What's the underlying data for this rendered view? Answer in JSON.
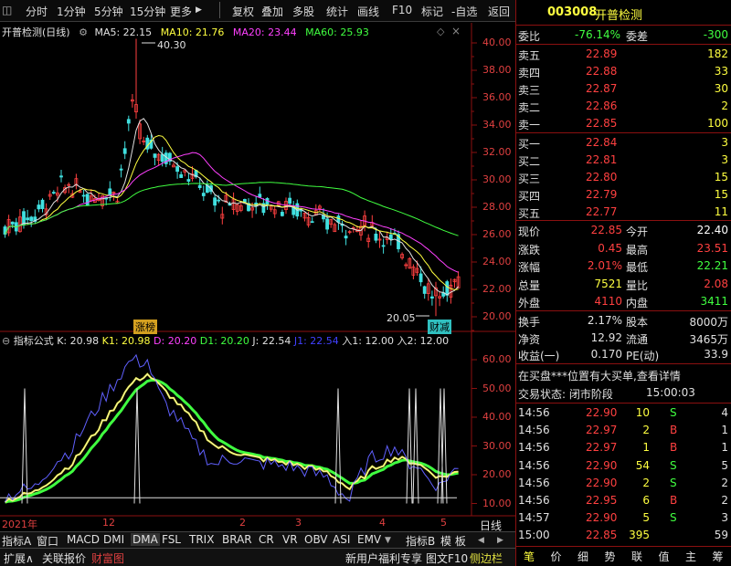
{
  "toolbar": {
    "items": [
      "分时",
      "1分钟",
      "5分钟",
      "15分钟",
      "更多",
      "复权",
      "叠加",
      "多股",
      "统计",
      "画线",
      "F10",
      "标记",
      "-自选",
      "返回"
    ]
  },
  "stock": {
    "code": "003008",
    "name": "开普检测",
    "period": "开普检测(日线)"
  },
  "ma": {
    "ma5": "MA5: 22.15",
    "ma10": "MA10: 21.76",
    "ma20": "MA20: 23.44",
    "ma60": "MA60: 25.93"
  },
  "price_axis": [
    "40.00",
    "38.00",
    "36.00",
    "34.00",
    "32.00",
    "30.00",
    "28.00",
    "26.00",
    "24.00",
    "22.00",
    "20.00"
  ],
  "annotations": {
    "high": "40.30",
    "low": "20.05",
    "tag1": "涨榜",
    "tag2": "财减"
  },
  "indicator": {
    "name": "指标公式",
    "k": "K: 20.98",
    "k1": "K1: 20.98",
    "d": "D: 20.20",
    "d1": "D1: 20.20",
    "j": "J: 22.54",
    "j1": "J1: 22.54",
    "in1": "入1: 12.00",
    "in2": "入2: 12.00"
  },
  "indicator_axis": [
    "60.00",
    "50.00",
    "40.00",
    "30.00",
    "20.00",
    "10.00"
  ],
  "time_axis": {
    "year": "2021年",
    "months": [
      "12",
      "2",
      "3",
      "4",
      "5"
    ],
    "period_btn": "日线"
  },
  "indicator_tabs": [
    "指标A",
    "窗口",
    "MACD",
    "DMI",
    "DMA",
    "FSL",
    "TRIX",
    "BRAR",
    "CR",
    "VR",
    "OBV",
    "ASI",
    "EMV"
  ],
  "indicator_tabs_right": [
    "指标B",
    "模 板"
  ],
  "bottom": {
    "left": [
      "扩展∧",
      "关联报价",
      "财富图"
    ],
    "right": [
      "新用户福利专享",
      "图文F10",
      "侧边栏"
    ]
  },
  "quote": {
    "weibi_label": "委比",
    "weibi": "-76.14%",
    "weicha_label": "委差",
    "weicha": "-300",
    "asks": [
      {
        "label": "卖五",
        "price": "22.89",
        "vol": "182"
      },
      {
        "label": "卖四",
        "price": "22.88",
        "vol": "33"
      },
      {
        "label": "卖三",
        "price": "22.87",
        "vol": "30"
      },
      {
        "label": "卖二",
        "price": "22.86",
        "vol": "2"
      },
      {
        "label": "卖一",
        "price": "22.85",
        "vol": "100"
      }
    ],
    "bids": [
      {
        "label": "买一",
        "price": "22.84",
        "vol": "3"
      },
      {
        "label": "买二",
        "price": "22.81",
        "vol": "3"
      },
      {
        "label": "买三",
        "price": "22.80",
        "vol": "15"
      },
      {
        "label": "买四",
        "price": "22.79",
        "vol": "15"
      },
      {
        "label": "买五",
        "price": "22.77",
        "vol": "11"
      }
    ],
    "stats": [
      {
        "l1": "现价",
        "v1": "22.85",
        "l2": "今开",
        "v2": "22.40",
        "c1": "#ff4040",
        "c2": "#ffffff"
      },
      {
        "l1": "涨跌",
        "v1": "0.45",
        "l2": "最高",
        "v2": "23.51",
        "c1": "#ff4040",
        "c2": "#ff4040"
      },
      {
        "l1": "涨幅",
        "v1": "2.01%",
        "l2": "最低",
        "v2": "22.21",
        "c1": "#ff4040",
        "c2": "#40ff40"
      },
      {
        "l1": "总量",
        "v1": "7521",
        "l2": "量比",
        "v2": "2.08",
        "c1": "#ffff40",
        "c2": "#ff4040"
      },
      {
        "l1": "外盘",
        "v1": "4110",
        "l2": "内盘",
        "v2": "3411",
        "c1": "#ff4040",
        "c2": "#40ff40"
      }
    ],
    "stats2": [
      {
        "l1": "换手",
        "v1": "2.17%",
        "l2": "股本",
        "v2": "8000万"
      },
      {
        "l1": "净资",
        "v1": "12.92",
        "l2": "流通",
        "v2": "3465万"
      },
      {
        "l1": "收益(一)",
        "v1": "0.170",
        "l2": "PE(动)",
        "v2": "33.9"
      }
    ],
    "notice": "在买盘***位置有大买单,查看详情",
    "status_label": "交易状态: 闭市阶段",
    "status_time": "15:00:03",
    "ticks": [
      {
        "t": "14:56",
        "p": "22.90",
        "v": "10",
        "bs": "S",
        "n": "4"
      },
      {
        "t": "14:56",
        "p": "22.97",
        "v": "2",
        "bs": "B",
        "n": "1"
      },
      {
        "t": "14:56",
        "p": "22.97",
        "v": "1",
        "bs": "B",
        "n": "1"
      },
      {
        "t": "14:56",
        "p": "22.90",
        "v": "54",
        "bs": "S",
        "n": "5"
      },
      {
        "t": "14:56",
        "p": "22.90",
        "v": "2",
        "bs": "S",
        "n": "2"
      },
      {
        "t": "14:56",
        "p": "22.95",
        "v": "6",
        "bs": "B",
        "n": "2"
      },
      {
        "t": "14:57",
        "p": "22.90",
        "v": "5",
        "bs": "S",
        "n": "3"
      },
      {
        "t": "15:00",
        "p": "22.85",
        "v": "395",
        "bs": "",
        "n": "59"
      }
    ],
    "bottom_tabs": [
      "笔",
      "价",
      "细",
      "势",
      "联",
      "值",
      "主",
      "筹"
    ]
  }
}
